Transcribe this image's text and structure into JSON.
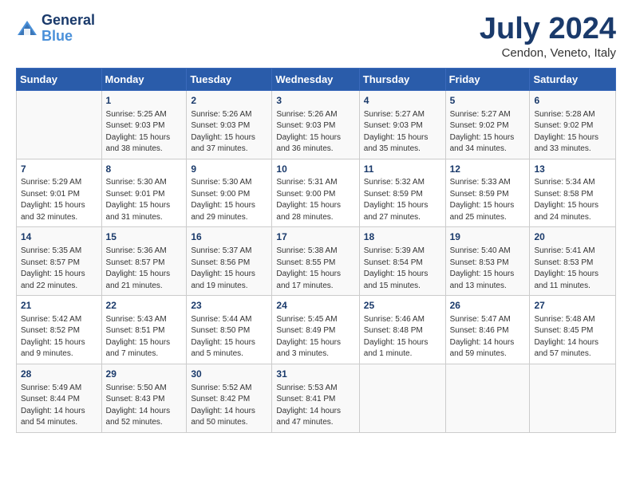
{
  "header": {
    "logo_line1": "General",
    "logo_line2": "Blue",
    "month": "July 2024",
    "location": "Cendon, Veneto, Italy"
  },
  "columns": [
    "Sunday",
    "Monday",
    "Tuesday",
    "Wednesday",
    "Thursday",
    "Friday",
    "Saturday"
  ],
  "weeks": [
    [
      {
        "day": "",
        "info": ""
      },
      {
        "day": "1",
        "info": "Sunrise: 5:25 AM\nSunset: 9:03 PM\nDaylight: 15 hours\nand 38 minutes."
      },
      {
        "day": "2",
        "info": "Sunrise: 5:26 AM\nSunset: 9:03 PM\nDaylight: 15 hours\nand 37 minutes."
      },
      {
        "day": "3",
        "info": "Sunrise: 5:26 AM\nSunset: 9:03 PM\nDaylight: 15 hours\nand 36 minutes."
      },
      {
        "day": "4",
        "info": "Sunrise: 5:27 AM\nSunset: 9:03 PM\nDaylight: 15 hours\nand 35 minutes."
      },
      {
        "day": "5",
        "info": "Sunrise: 5:27 AM\nSunset: 9:02 PM\nDaylight: 15 hours\nand 34 minutes."
      },
      {
        "day": "6",
        "info": "Sunrise: 5:28 AM\nSunset: 9:02 PM\nDaylight: 15 hours\nand 33 minutes."
      }
    ],
    [
      {
        "day": "7",
        "info": "Sunrise: 5:29 AM\nSunset: 9:01 PM\nDaylight: 15 hours\nand 32 minutes."
      },
      {
        "day": "8",
        "info": "Sunrise: 5:30 AM\nSunset: 9:01 PM\nDaylight: 15 hours\nand 31 minutes."
      },
      {
        "day": "9",
        "info": "Sunrise: 5:30 AM\nSunset: 9:00 PM\nDaylight: 15 hours\nand 29 minutes."
      },
      {
        "day": "10",
        "info": "Sunrise: 5:31 AM\nSunset: 9:00 PM\nDaylight: 15 hours\nand 28 minutes."
      },
      {
        "day": "11",
        "info": "Sunrise: 5:32 AM\nSunset: 8:59 PM\nDaylight: 15 hours\nand 27 minutes."
      },
      {
        "day": "12",
        "info": "Sunrise: 5:33 AM\nSunset: 8:59 PM\nDaylight: 15 hours\nand 25 minutes."
      },
      {
        "day": "13",
        "info": "Sunrise: 5:34 AM\nSunset: 8:58 PM\nDaylight: 15 hours\nand 24 minutes."
      }
    ],
    [
      {
        "day": "14",
        "info": "Sunrise: 5:35 AM\nSunset: 8:57 PM\nDaylight: 15 hours\nand 22 minutes."
      },
      {
        "day": "15",
        "info": "Sunrise: 5:36 AM\nSunset: 8:57 PM\nDaylight: 15 hours\nand 21 minutes."
      },
      {
        "day": "16",
        "info": "Sunrise: 5:37 AM\nSunset: 8:56 PM\nDaylight: 15 hours\nand 19 minutes."
      },
      {
        "day": "17",
        "info": "Sunrise: 5:38 AM\nSunset: 8:55 PM\nDaylight: 15 hours\nand 17 minutes."
      },
      {
        "day": "18",
        "info": "Sunrise: 5:39 AM\nSunset: 8:54 PM\nDaylight: 15 hours\nand 15 minutes."
      },
      {
        "day": "19",
        "info": "Sunrise: 5:40 AM\nSunset: 8:53 PM\nDaylight: 15 hours\nand 13 minutes."
      },
      {
        "day": "20",
        "info": "Sunrise: 5:41 AM\nSunset: 8:53 PM\nDaylight: 15 hours\nand 11 minutes."
      }
    ],
    [
      {
        "day": "21",
        "info": "Sunrise: 5:42 AM\nSunset: 8:52 PM\nDaylight: 15 hours\nand 9 minutes."
      },
      {
        "day": "22",
        "info": "Sunrise: 5:43 AM\nSunset: 8:51 PM\nDaylight: 15 hours\nand 7 minutes."
      },
      {
        "day": "23",
        "info": "Sunrise: 5:44 AM\nSunset: 8:50 PM\nDaylight: 15 hours\nand 5 minutes."
      },
      {
        "day": "24",
        "info": "Sunrise: 5:45 AM\nSunset: 8:49 PM\nDaylight: 15 hours\nand 3 minutes."
      },
      {
        "day": "25",
        "info": "Sunrise: 5:46 AM\nSunset: 8:48 PM\nDaylight: 15 hours\nand 1 minute."
      },
      {
        "day": "26",
        "info": "Sunrise: 5:47 AM\nSunset: 8:46 PM\nDaylight: 14 hours\nand 59 minutes."
      },
      {
        "day": "27",
        "info": "Sunrise: 5:48 AM\nSunset: 8:45 PM\nDaylight: 14 hours\nand 57 minutes."
      }
    ],
    [
      {
        "day": "28",
        "info": "Sunrise: 5:49 AM\nSunset: 8:44 PM\nDaylight: 14 hours\nand 54 minutes."
      },
      {
        "day": "29",
        "info": "Sunrise: 5:50 AM\nSunset: 8:43 PM\nDaylight: 14 hours\nand 52 minutes."
      },
      {
        "day": "30",
        "info": "Sunrise: 5:52 AM\nSunset: 8:42 PM\nDaylight: 14 hours\nand 50 minutes."
      },
      {
        "day": "31",
        "info": "Sunrise: 5:53 AM\nSunset: 8:41 PM\nDaylight: 14 hours\nand 47 minutes."
      },
      {
        "day": "",
        "info": ""
      },
      {
        "day": "",
        "info": ""
      },
      {
        "day": "",
        "info": ""
      }
    ]
  ]
}
